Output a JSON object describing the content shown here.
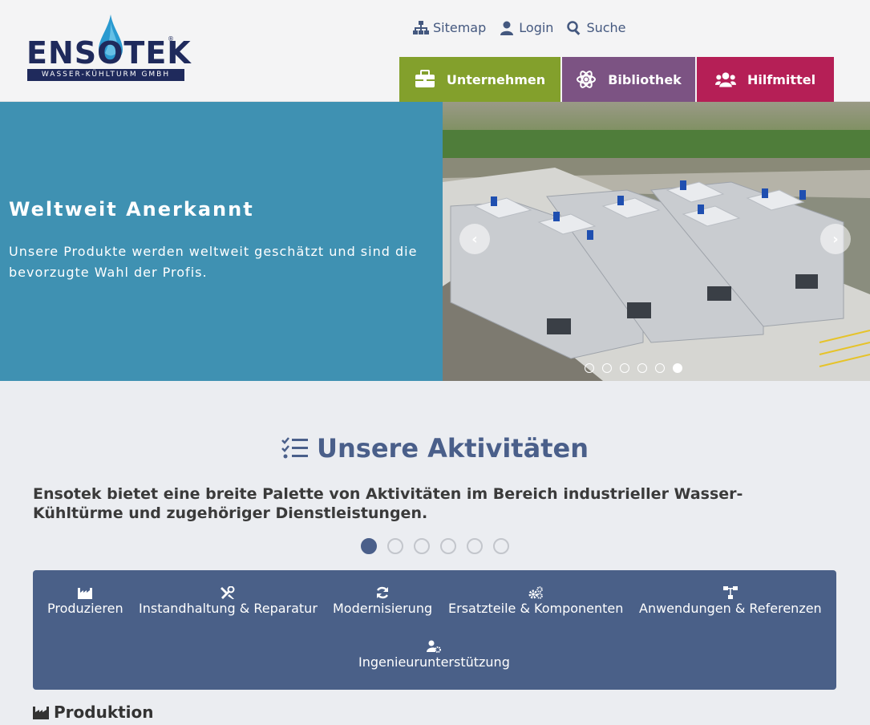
{
  "brand": {
    "logo_text": "ENSOTEK",
    "logo_subtitle": "WASSER-KÜHLTURM GMBH",
    "logo_mark": "®",
    "colors": {
      "navy": "#1f2a5c",
      "drop": "#2a9ad0"
    }
  },
  "toplinks": {
    "sitemap": "Sitemap",
    "login": "Login",
    "search": "Suche"
  },
  "mainnav": {
    "company": {
      "label": "Unternehmen",
      "color": "#83a02c",
      "icon": "briefcase-icon"
    },
    "library": {
      "label": "Bibliothek",
      "color": "#7c5383",
      "icon": "atom-icon"
    },
    "tools": {
      "label": "Hilfmittel",
      "color": "#b51f56",
      "icon": "users-icon"
    }
  },
  "hero": {
    "title": "Weltweit Anerkannt",
    "body": "Unsere Produkte werden weltweit geschätzt und sind die bevorzugte Wahl der Profis.",
    "prev_label": "‹",
    "next_label": "›",
    "slide_count": 6,
    "active_slide": 6,
    "background": "#3f91b2"
  },
  "activities": {
    "title": "Unsere Aktivitäten",
    "lead": "Ensotek bietet eine breite Palette von Aktivitäten im Bereich industrieller Wasser-Kühltürme und zugehöriger Dienstleistungen.",
    "page_count": 6,
    "active_page": 1,
    "items": [
      {
        "label": "Produzieren",
        "icon": "factory-icon"
      },
      {
        "label": "Instandhaltung & Reparatur",
        "icon": "tools-icon"
      },
      {
        "label": "Modernisierung",
        "icon": "refresh-icon"
      },
      {
        "label": "Ersatzteile & Komponenten",
        "icon": "cogs-icon"
      },
      {
        "label": "Anwendungen & Referenzen",
        "icon": "sitemap-icon"
      },
      {
        "label": "Ingenieurunterstützung",
        "icon": "user-cog-icon"
      }
    ],
    "section_heading": "Produktion"
  }
}
